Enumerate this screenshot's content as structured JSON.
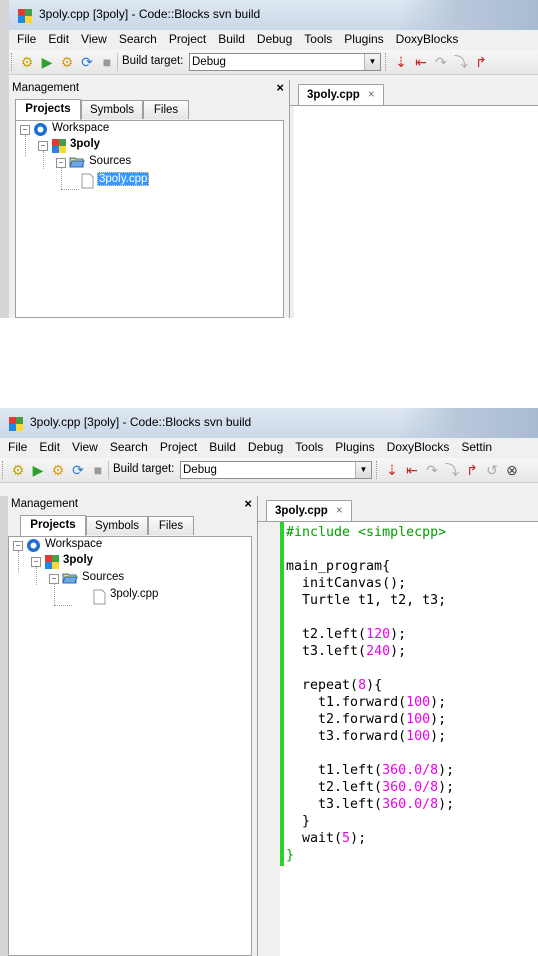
{
  "app": {
    "title": "3poly.cpp [3poly] - Code::Blocks svn build",
    "brand_colors": {
      "selection": "#3399ff",
      "changebar": "#27d527",
      "number": "#ee00ee",
      "preprocessor": "#00a000"
    }
  },
  "menu": {
    "items_top": [
      "File",
      "Edit",
      "View",
      "Search",
      "Project",
      "Build",
      "Debug",
      "Tools",
      "Plugins",
      "DoxyBlocks"
    ],
    "items_bottom": [
      "File",
      "Edit",
      "View",
      "Search",
      "Project",
      "Build",
      "Debug",
      "Tools",
      "Plugins",
      "DoxyBlocks",
      "Settin"
    ]
  },
  "toolbar": {
    "build_target_label": "Build target:",
    "build_target_value": "Debug",
    "icons": [
      "build-gear-icon",
      "run-icon",
      "build-and-run-icon",
      "rebuild-icon",
      "stop-icon",
      "debug-icon",
      "run-to-cursor-icon",
      "step-into-icon",
      "next-line-icon",
      "step-out-icon",
      "step-instruction-icon",
      "abort-icon"
    ]
  },
  "management": {
    "title": "Management",
    "close": "×",
    "tabs": [
      "Projects",
      "Symbols",
      "Files"
    ],
    "tree": {
      "workspace": "Workspace",
      "project": "3poly",
      "folder": "Sources",
      "file": "3poly.cpp"
    }
  },
  "editor": {
    "tab_label": "3poly.cpp",
    "tab_close": "×",
    "code_lines": [
      [
        {
          "t": "#include <simplecpp>",
          "c": "pp"
        }
      ],
      [],
      [
        {
          "t": "main_program{",
          "c": "kw"
        }
      ],
      [
        {
          "t": "  initCanvas();",
          "c": "kw"
        }
      ],
      [
        {
          "t": "  Turtle t1, t2, t3;",
          "c": "kw"
        }
      ],
      [],
      [
        {
          "t": "  t2.left(",
          "c": "kw"
        },
        {
          "t": "120",
          "c": "num"
        },
        {
          "t": ");",
          "c": "kw"
        }
      ],
      [
        {
          "t": "  t3.left(",
          "c": "kw"
        },
        {
          "t": "240",
          "c": "num"
        },
        {
          "t": ");",
          "c": "kw"
        }
      ],
      [],
      [
        {
          "t": "  repeat(",
          "c": "kw"
        },
        {
          "t": "8",
          "c": "num"
        },
        {
          "t": "){",
          "c": "kw"
        }
      ],
      [
        {
          "t": "    t1.forward(",
          "c": "kw"
        },
        {
          "t": "100",
          "c": "num"
        },
        {
          "t": ");",
          "c": "kw"
        }
      ],
      [
        {
          "t": "    t2.forward(",
          "c": "kw"
        },
        {
          "t": "100",
          "c": "num"
        },
        {
          "t": ");",
          "c": "kw"
        }
      ],
      [
        {
          "t": "    t3.forward(",
          "c": "kw"
        },
        {
          "t": "100",
          "c": "num"
        },
        {
          "t": ");",
          "c": "kw"
        }
      ],
      [],
      [
        {
          "t": "    t1.left(",
          "c": "kw"
        },
        {
          "t": "360.0/8",
          "c": "num"
        },
        {
          "t": ");",
          "c": "kw"
        }
      ],
      [
        {
          "t": "    t2.left(",
          "c": "kw"
        },
        {
          "t": "360.0/8",
          "c": "num"
        },
        {
          "t": ");",
          "c": "kw"
        }
      ],
      [
        {
          "t": "    t3.left(",
          "c": "kw"
        },
        {
          "t": "360.0/8",
          "c": "num"
        },
        {
          "t": ");",
          "c": "kw"
        }
      ],
      [
        {
          "t": "  }",
          "c": "kw"
        }
      ],
      [
        {
          "t": "  wait(",
          "c": "kw"
        },
        {
          "t": "5",
          "c": "num"
        },
        {
          "t": ");",
          "c": "kw"
        }
      ],
      [
        {
          "t": "}",
          "c": "pp"
        }
      ]
    ]
  }
}
